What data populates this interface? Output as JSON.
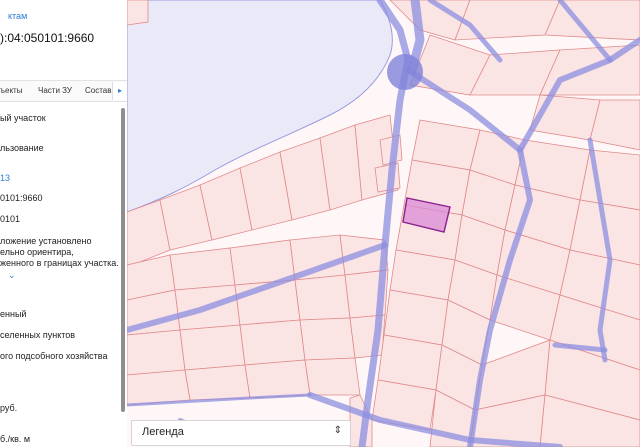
{
  "panel": {
    "back_link": "ктам",
    "cadastral_number": "):04:050101:9660",
    "tabs": [
      "ъекты",
      "Части ЗУ",
      "Состав"
    ],
    "tab_more_icon": "chevron-right-icon",
    "fields": [
      "ый участок",
      "льзование",
      "13",
      "0101:9660",
      "0101",
      "ложение установлено",
      "ельно ориентира,",
      "женного в границах участка.",
      "енный",
      "селенных пунктов",
      "ого подсобного хозяйства",
      "руб.",
      "б./кв. м"
    ],
    "expand_icon": "chevron-down-icon"
  },
  "map": {
    "legend_label": "Легенда",
    "legend_icon": "sort-updown-icon",
    "colors": {
      "water": "#e9e9f7",
      "parcel_fill": "#fbe4e4",
      "parcel_border": "#e08a8a",
      "road": "#8c8fe0",
      "selected_fill": "#d98bd6",
      "selected_border": "#8a1f8f"
    }
  }
}
